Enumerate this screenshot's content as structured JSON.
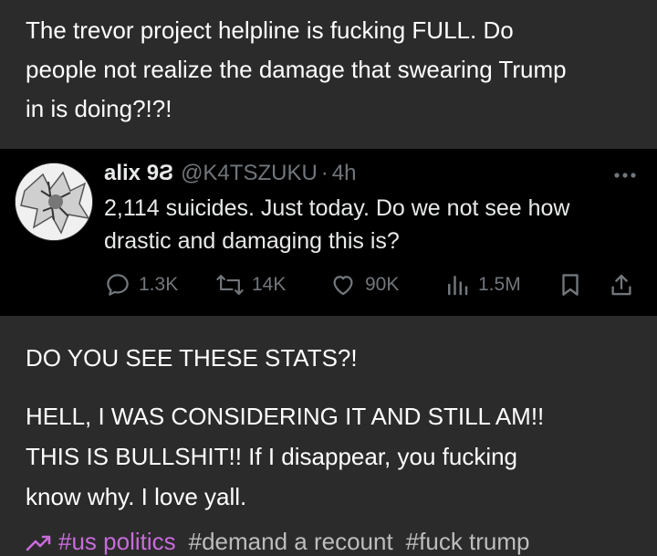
{
  "post": {
    "text_lines": [
      "The trevor project helpline is fucking FULL. Do",
      "people not realize the damage that swearing Trump",
      "in is doing?!?!"
    ]
  },
  "tweet": {
    "name": "alix 9Ϩ",
    "handle": "@K4TSZUKU",
    "separator": "·",
    "time": "4h",
    "more_icon": "more-icon",
    "body_lines": [
      "2,114 suicides. Just today. Do we not see how",
      "drastic and damaging this is?"
    ],
    "stats": {
      "replies": "1.3K",
      "retweets": "14K",
      "likes": "90K",
      "views": "1.5M"
    }
  },
  "comment": {
    "line1": "DO YOU SEE THESE STATS?!",
    "line2": "HELL, I WAS CONSIDERING IT AND STILL AM!!",
    "line3": "THIS IS BULLSHIT!! If I disappear, you fucking",
    "line4": "know why. I love yall."
  },
  "tags": [
    "#us politics",
    "#demand a recount",
    "#fuck trump"
  ],
  "colors": {
    "background": "#2b2b2b",
    "tweet_bg": "#000000",
    "tweet_muted": "#71767b",
    "tag_accent": "#c96bdc"
  }
}
